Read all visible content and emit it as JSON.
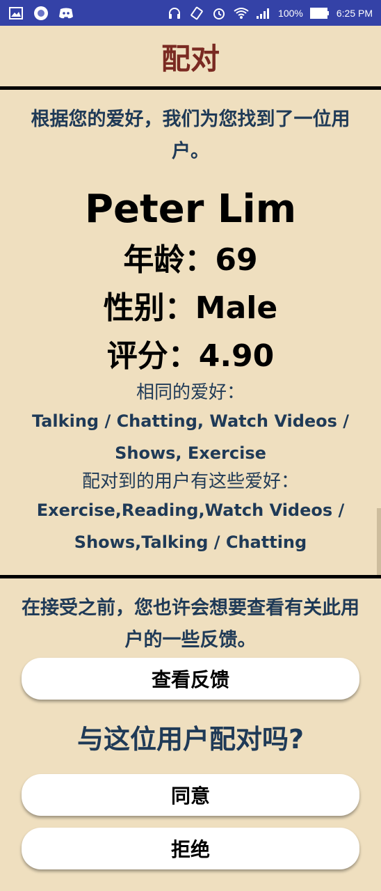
{
  "status_bar": {
    "battery_text": "100%",
    "time": "6:25 PM",
    "left_icons": [
      "gallery-icon",
      "circle-app-icon",
      "discord-icon"
    ],
    "right_icons": [
      "headphones-icon",
      "rotate-icon",
      "alarm-icon",
      "wifi-icon",
      "signal-icon",
      "battery-icon"
    ]
  },
  "header": {
    "title": "配对"
  },
  "match": {
    "intro": "根据您的爱好，我们为您找到了一位用户。",
    "name": "Peter Lim",
    "age": "年龄：69",
    "gender": "性别：Male",
    "rating": "评分：4.90",
    "common_label": "相同的爱好：",
    "common_hobbies": "Talking / Chatting, Watch Videos / Shows, Exercise",
    "user_label": "配对到的用户有这些爱好：",
    "user_hobbies": "Exercise,Reading,Watch Videos / Shows,Talking / Chatting"
  },
  "feedback": {
    "note": "在接受之前，您也许会想要查看有关此用户的一些反馈。",
    "view_button": "查看反馈",
    "question": "与这位用户配对吗?",
    "accept_button": "同意",
    "reject_button": "拒绝"
  },
  "colors": {
    "background": "#efdfbf",
    "status_bar": "#3442a7",
    "header_text": "#7a2a22",
    "body_text": "#1f3a57"
  }
}
